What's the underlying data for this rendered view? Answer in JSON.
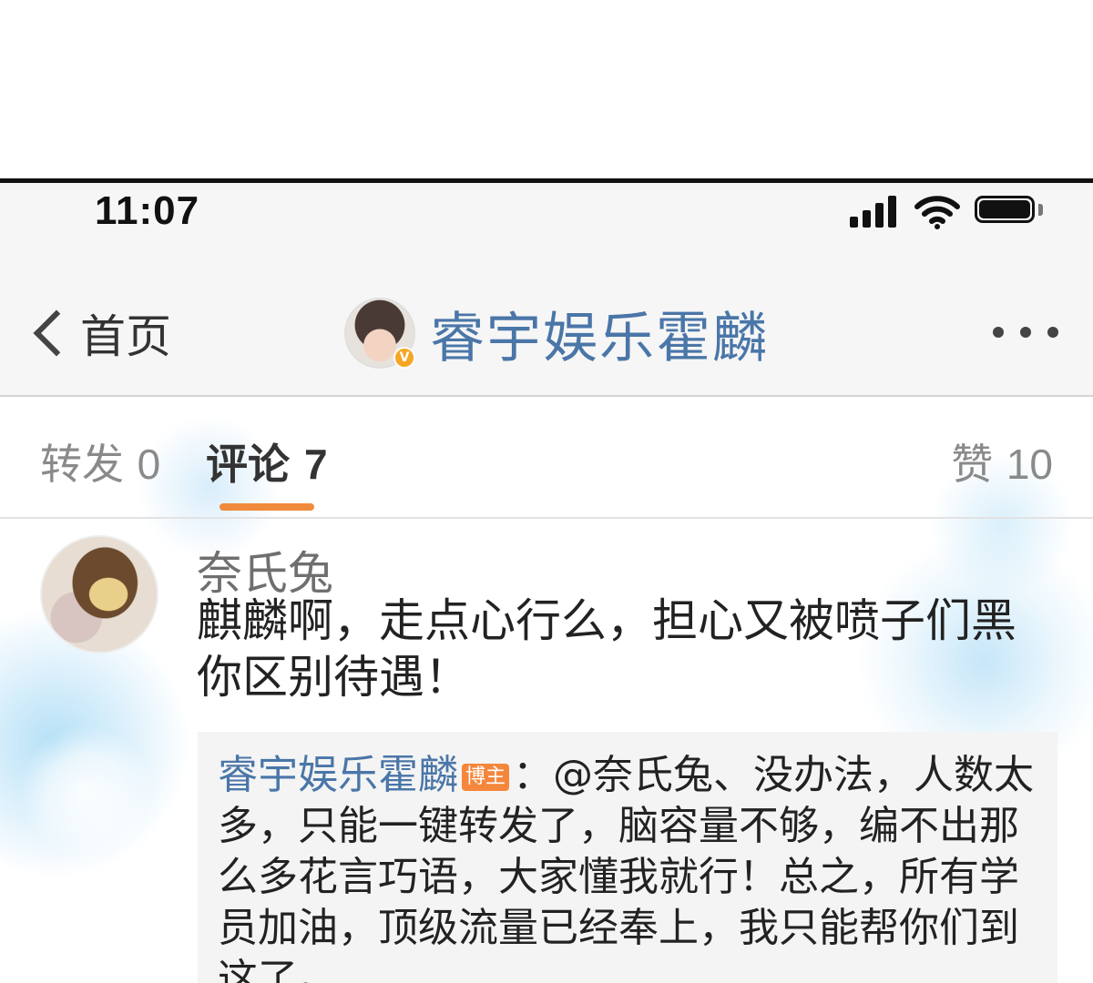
{
  "status_bar": {
    "time": "11:07",
    "icons": [
      "signal-icon",
      "wifi-icon",
      "battery-icon"
    ]
  },
  "nav": {
    "back_label": "首页",
    "title": "睿宇娱乐霍麟",
    "verified_mark": "V",
    "icons": [
      "back-chevron-icon",
      "more-icon"
    ]
  },
  "tabs": [
    {
      "label": "转发",
      "count": "0"
    },
    {
      "label": "评论",
      "count": "7",
      "active": true
    },
    {
      "label": "赞",
      "count": "10"
    }
  ],
  "comment": {
    "username": "奈氏兔",
    "text": "麒麟啊，走点心行么，担心又被喷子们黑你区别待遇！"
  },
  "reply": {
    "username": "睿宇娱乐霍麟",
    "badge": "博主",
    "text": "：@奈氏兔、没办法，人数太多，只能一键转发了，脑容量不够，编不出那么多花言巧语，大家懂我就行！总之，所有学员加油，顶级流量已经奉上，我只能帮你们到这了。"
  },
  "colors": {
    "accent": "#4a76a8",
    "tab_underline": "#f08a3c",
    "badge": "#f4873c",
    "verified": "#f5a623"
  }
}
